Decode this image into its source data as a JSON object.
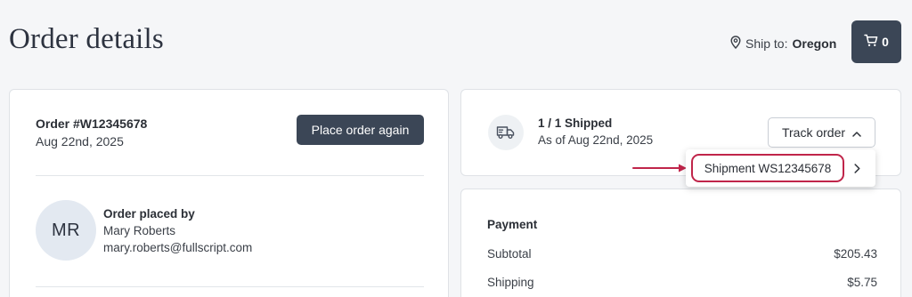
{
  "header": {
    "title": "Order details",
    "ship_to_label": "Ship to:",
    "ship_to_state": "Oregon",
    "cart_count": "0"
  },
  "order": {
    "number": "Order #W12345678",
    "date": "Aug 22nd, 2025",
    "reorder_label": "Place order again",
    "placed_by": {
      "initials": "MR",
      "label": "Order placed by",
      "name": "Mary Roberts",
      "email": "mary.roberts@fullscript.com"
    }
  },
  "shipping": {
    "status": "1 / 1 Shipped",
    "as_of": "As of Aug 22nd, 2025",
    "track_label": "Track order",
    "shipments": [
      "Shipment WS12345678"
    ]
  },
  "payment": {
    "title": "Payment",
    "rows": [
      {
        "label": "Subtotal",
        "value": "$205.43"
      },
      {
        "label": "Shipping",
        "value": "$5.75"
      }
    ]
  },
  "colors": {
    "primary_button": "#3b4656",
    "highlight": "#c0254a"
  },
  "icons": {
    "location": "map-pin-icon",
    "cart": "shopping-cart-icon",
    "truck": "delivery-truck-icon",
    "chevron_up": "chevron-up-icon",
    "chevron_right": "chevron-right-icon"
  }
}
